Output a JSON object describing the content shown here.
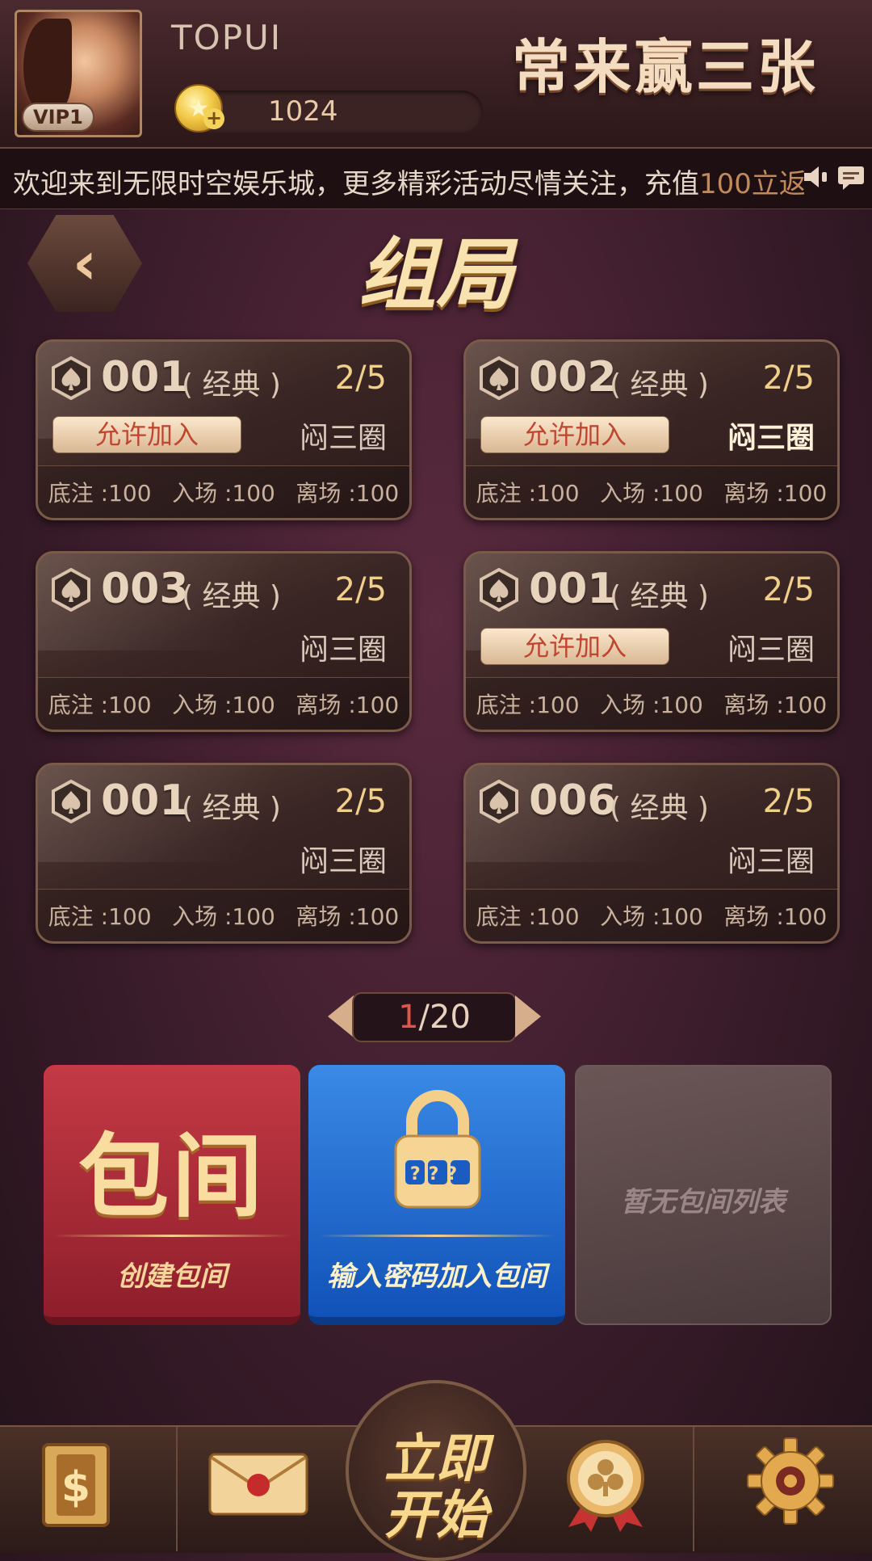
{
  "header": {
    "username": "TOPUI",
    "vip": "VIP1",
    "coins": "1024",
    "game_title": "常来赢三张"
  },
  "marquee": {
    "text": "欢迎来到无限时空娱乐城，更多精彩活动尽情关注，充值",
    "highlight": "100立返"
  },
  "section": {
    "title": "组局",
    "back_symbol": "‹"
  },
  "rooms": [
    {
      "id": "001",
      "mode": "( 经典 )",
      "count": "2/5",
      "type": "闷三圈",
      "join": "允许加入",
      "stats": [
        "底注 :100",
        "入场 :100",
        "离场 :100"
      ]
    },
    {
      "id": "002",
      "mode": "( 经典 )",
      "count": "2/5",
      "type": "闷三圈",
      "join": "允许加入",
      "stats": [
        "底注 :100",
        "入场 :100",
        "离场 :100"
      ]
    },
    {
      "id": "003",
      "mode": "( 经典 )",
      "count": "2/5",
      "type": "闷三圈",
      "stats": [
        "底注 :100",
        "入场 :100",
        "离场 :100"
      ]
    },
    {
      "id": "001",
      "mode": "( 经典 )",
      "count": "2/5",
      "type": "闷三圈",
      "join": "允许加入",
      "stats": [
        "底注 :100",
        "入场 :100",
        "离场 :100"
      ]
    },
    {
      "id": "001",
      "mode": "( 经典 )",
      "count": "2/5",
      "type": "闷三圈",
      "stats": [
        "底注 :100",
        "入场 :100",
        "离场 :100"
      ]
    },
    {
      "id": "006",
      "mode": "( 经典 )",
      "count": "2/5",
      "type": "闷三圈",
      "stats": [
        "底注 :100",
        "入场 :100",
        "离场 :100"
      ]
    }
  ],
  "pager": {
    "current": "1",
    "rest": "/20"
  },
  "panels": {
    "private_room": {
      "title": "包间",
      "caption": "创建包间"
    },
    "password": {
      "lock_text": "???",
      "caption": "输入密码加入包间"
    },
    "empty": {
      "text": "暂无包间列表"
    }
  },
  "bottom_nav": {
    "start_line1": "立即",
    "start_line2": "开始",
    "icons": [
      "shop-icon",
      "mail-icon",
      "club-medal-icon",
      "settings-gear-icon"
    ]
  },
  "colors": {
    "accent_gold": "#f7d88c",
    "red_panel": "#c43a45",
    "blue_panel": "#3a8ae6",
    "bg": "#3a1c2a"
  }
}
